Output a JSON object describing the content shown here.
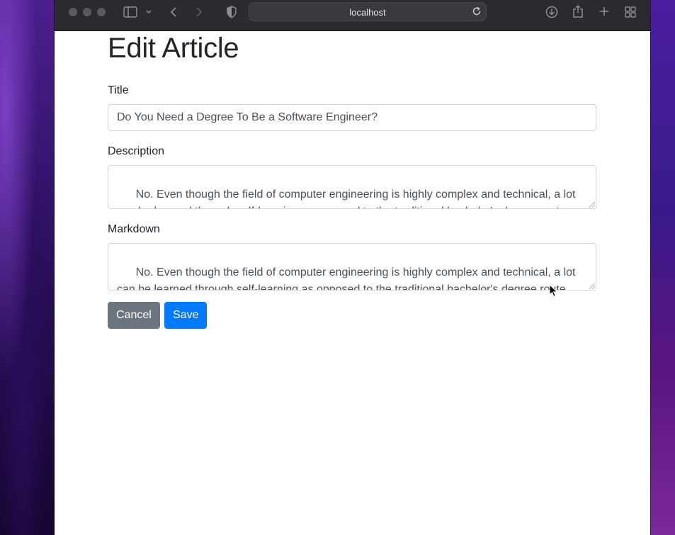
{
  "browser": {
    "address": "localhost"
  },
  "page": {
    "title": "Edit Article",
    "fields": {
      "title_label": "Title",
      "title_value": "Do You Need a Degree To Be a Software Engineer?",
      "description_label": "Description",
      "description_value": "No. Even though the field of computer engineering is highly complex and technical, a lot can be learned through self-learning as opposed to the traditional bachelor's degree route.",
      "markdown_label": "Markdown",
      "markdown_value": "No. Even though the field of computer engineering is highly complex and technical, a lot can be learned through self-learning as opposed to the traditional bachelor's degree route. First and foremost you have to make sure that you are self-learning optimally. Are you"
    },
    "buttons": {
      "cancel": "Cancel",
      "save": "Save"
    }
  },
  "colors": {
    "cancel": "#6c757d",
    "save": "#007bff"
  },
  "icons": [
    "sidebar-icon",
    "chevron-down-icon",
    "back-icon",
    "forward-icon",
    "shield-icon",
    "reload-icon",
    "download-icon",
    "share-icon",
    "new-tab-icon",
    "tab-overview-icon",
    "mouse-pointer-icon"
  ]
}
